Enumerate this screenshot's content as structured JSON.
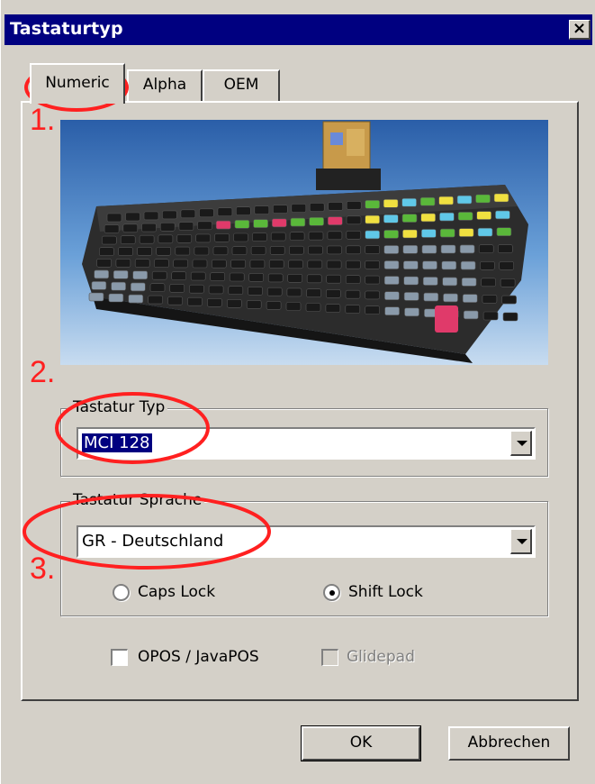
{
  "window": {
    "title": "Tastaturtyp",
    "close_glyph": "×"
  },
  "tabs": [
    {
      "label": "Numeric",
      "active": true
    },
    {
      "label": "Alpha",
      "active": false
    },
    {
      "label": "OEM",
      "active": false
    }
  ],
  "image": {
    "description_icon": "pos-keyboard-photo"
  },
  "keyboard_type": {
    "group_label": "Tastatur Typ",
    "value": "MCI 128"
  },
  "keyboard_language": {
    "group_label": "Tastatur Sprache",
    "value": "GR - Deutschland",
    "radios": [
      {
        "label": "Caps Lock",
        "checked": false
      },
      {
        "label": "Shift Lock",
        "checked": true
      }
    ]
  },
  "options": [
    {
      "label": "OPOS / JavaPOS",
      "checked": false,
      "enabled": true
    },
    {
      "label": "Glidepad",
      "checked": false,
      "enabled": false
    }
  ],
  "buttons": {
    "ok": "OK",
    "cancel": "Abbrechen"
  },
  "annotations": {
    "step1": "1.",
    "step2": "2.",
    "step3": "3.",
    "color": "#ff2020"
  }
}
